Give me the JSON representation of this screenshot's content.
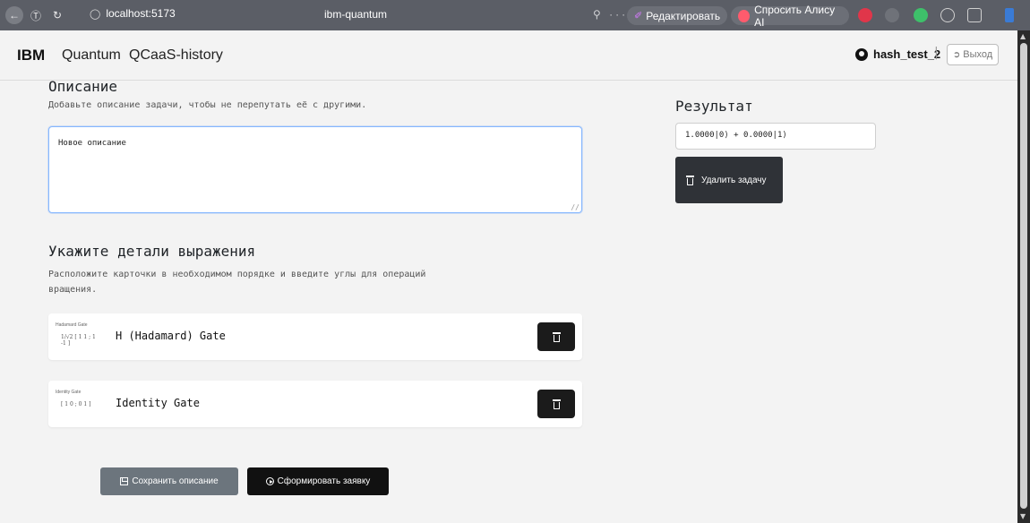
{
  "browser": {
    "url": "localhost:5173",
    "tab_title": "ibm-quantum",
    "edit_label": "Редактировать",
    "alice_label": "Спросить Алису AI",
    "toolbar_icons": "⚲ ··· ☐"
  },
  "header": {
    "brand": "IBM",
    "nav": [
      "Quantum",
      "QCaaS-history"
    ],
    "username": "hash_test_2",
    "separator": "|",
    "logout_label": "Выход"
  },
  "description": {
    "title": "Описание",
    "subtitle": "Добавьте описание задачи, чтобы не перепутать её с другими.",
    "value": "Новое описание"
  },
  "result": {
    "title": "Результат",
    "value": "1.0000|0⟩ + 0.0000|1⟩",
    "delete_label": "Удалить задачу"
  },
  "details": {
    "title": "Укажите детали выражения",
    "subtitle": "Расположите карточки в необходимом порядке и введите углы для операций вращения."
  },
  "gates": [
    {
      "thumb_title": "Hadamard Gate",
      "thumb_matrix": "1/√2 [ 1 1 ; 1 -1 ]",
      "name": "H (Hadamard) Gate"
    },
    {
      "thumb_title": "Identity Gate",
      "thumb_matrix": "[ 1 0 ; 0 1 ]",
      "name": "Identity Gate"
    }
  ],
  "actions": {
    "save_label": "Сохранить описание",
    "form_label": "Сформировать заявку"
  },
  "colors": {
    "accent_focus": "#86b7fe",
    "dark_button": "#1b1b1b",
    "secondary_button": "#6c757d"
  }
}
